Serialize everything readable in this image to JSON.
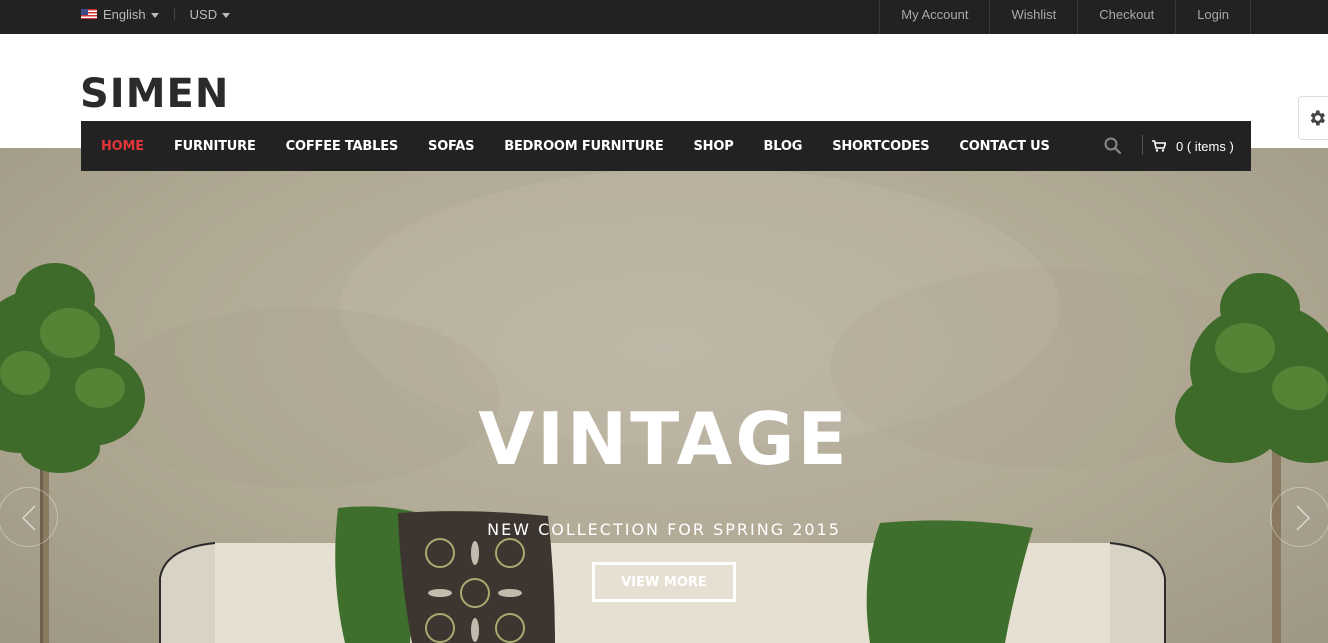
{
  "topbar": {
    "language": "English",
    "currency": "USD",
    "links": [
      "My Account",
      "Wishlist",
      "Checkout",
      "Login"
    ]
  },
  "header": {
    "logo": "SIMEN"
  },
  "nav": {
    "items": [
      "HOME",
      "FURNITURE",
      "COFFEE TABLES",
      "SOFAS",
      "BEDROOM FURNITURE",
      "SHOP",
      "BLOG",
      "SHORTCODES",
      "CONTACT US"
    ],
    "active_index": 0,
    "cart_count": "0",
    "cart_label": "( items )"
  },
  "slide": {
    "title": "VINTAGE",
    "subtitle": "NEW COLLECTION FOR SPRING 2015",
    "button": "VIEW MORE"
  },
  "icons": [
    "flag-icon",
    "chevron-down-icon",
    "gear-icon",
    "search-icon",
    "cart-icon",
    "chevron-left-icon",
    "chevron-right-icon"
  ],
  "colors": {
    "dark": "#222222",
    "accent": "#e0353b",
    "white": "#ffffff"
  }
}
